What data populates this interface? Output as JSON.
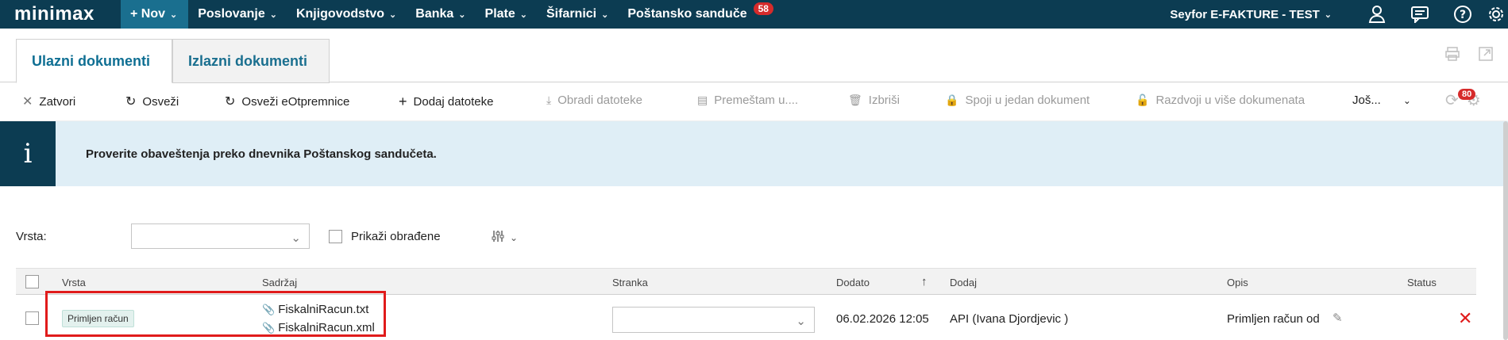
{
  "topbar": {
    "logo": "minimax",
    "new_label": "+ Nov",
    "menu": [
      {
        "label": "Poslovanje"
      },
      {
        "label": "Knjigovodstvo"
      },
      {
        "label": "Banka"
      },
      {
        "label": "Plate"
      },
      {
        "label": "Šifarnici"
      },
      {
        "label": "Poštansko sanduče"
      }
    ],
    "mailbox_badge": "58",
    "company": "Seyfor E-FAKTURE - TEST",
    "icons": [
      "user-icon",
      "messages-icon",
      "help-icon",
      "settings-icon"
    ]
  },
  "tabs": {
    "incoming": "Ulazni dokumenti",
    "outgoing": "Izlazni dokumenti"
  },
  "toolbar": {
    "close": "Zatvori",
    "refresh": "Osveži",
    "refresh_edelivery": "Osveži eOtpremnice",
    "add_files": "Dodaj datoteke",
    "process_files": "Obradi datoteke",
    "move": "Premeštam u....",
    "delete": "Izbriši",
    "merge": "Spoji u jedan dokument",
    "split": "Razdvoji u više dokumenata",
    "more": "Još...",
    "notif_badge": "80"
  },
  "info": {
    "message": "Proverite obaveštenja preko dnevnika Poštanskog sandučeta."
  },
  "filter": {
    "type_label": "Vrsta:",
    "show_processed": "Prikaži obrađene"
  },
  "table": {
    "headers": {
      "type": "Vrsta",
      "content": "Sadržaj",
      "party": "Stranka",
      "added": "Dodato",
      "added_by": "Dodaj",
      "description": "Opis",
      "status": "Status"
    },
    "rows": [
      {
        "type": "Primljen račun",
        "files": [
          "FiskalniRacun.txt",
          "FiskalniRacun.xml"
        ],
        "added": "06.02.2026 12:05",
        "added_by": "API (Ivana Djordjevic )",
        "description": "Primljen račun od"
      }
    ]
  },
  "colors": {
    "nav_bg": "#0c3c52",
    "accent": "#1a6f8f",
    "info_bg": "#dfeef6",
    "highlight": "#e01b1b",
    "delete_x": "#e01b1b"
  }
}
